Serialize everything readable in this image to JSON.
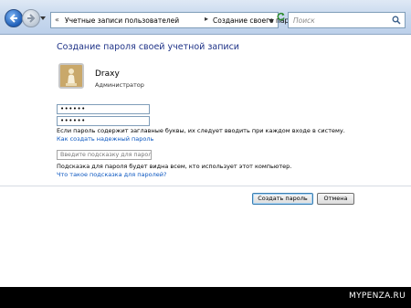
{
  "nav": {
    "breadcrumb_parent": "Учетные записи пользователей",
    "breadcrumb_current": "Создание своего пароля",
    "search_placeholder": "Поиск"
  },
  "page": {
    "title": "Создание пароля своей учетной записи",
    "user_name": "Draxy",
    "user_role": "Администратор",
    "password_value": "••••••",
    "password_confirm_value": "••••••",
    "caps_note": "Если пароль содержит заглавные буквы, их следует вводить при каждом входе в систему.",
    "strong_password_link": "Как создать надежный пароль",
    "hint_placeholder": "Введите подсказку для пароля",
    "hint_note": "Подсказка для пароля будет видна всем, кто использует этот компьютер.",
    "hint_link": "Что такое подсказка для паролей?"
  },
  "buttons": {
    "create": "Создать пароль",
    "cancel": "Отмена"
  },
  "watermark": "MYPENZA.RU",
  "colors": {
    "title_blue": "#1e3287",
    "link_blue": "#0a56c0"
  }
}
